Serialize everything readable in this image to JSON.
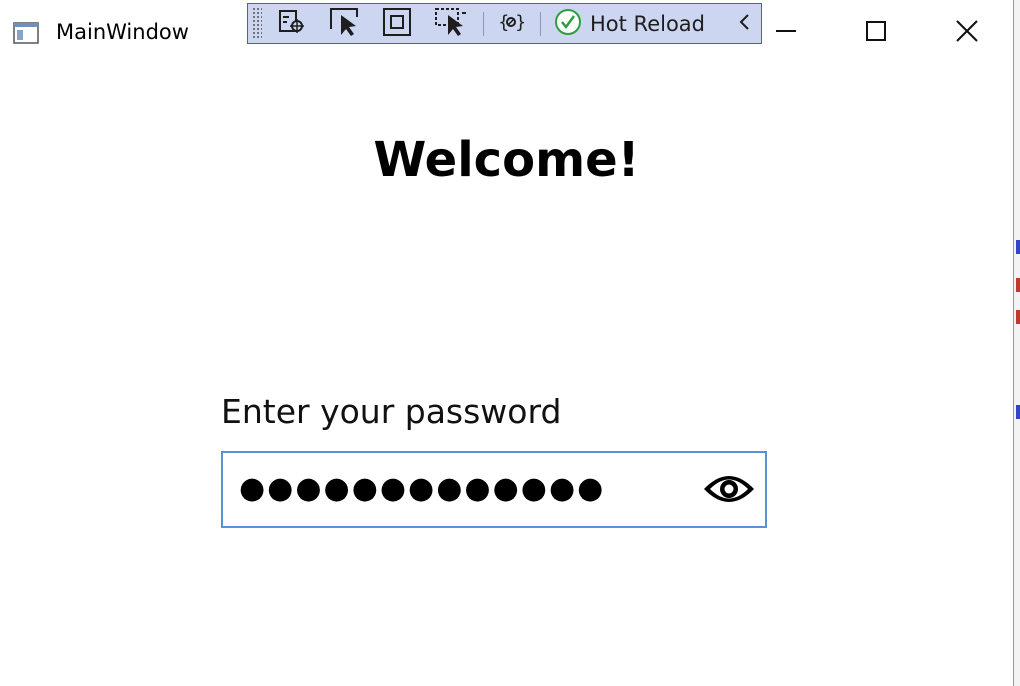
{
  "window": {
    "title": "MainWindow",
    "icons": [
      "app-icon",
      "minimize-icon",
      "maximize-icon",
      "close-icon"
    ]
  },
  "devbar": {
    "tools": [
      "visual-tree-icon",
      "select-element-icon",
      "display-adorners-icon",
      "track-focus-icon",
      "binding-failures-icon",
      "hot-reload-icon",
      "collapse-chevron-icon"
    ],
    "hot_reload_label": "Hot Reload",
    "status_color": "#2e9e3e"
  },
  "main": {
    "heading": "Welcome!",
    "password_label": "Enter your password",
    "password_mask": "●●●●●●●●●●●●●",
    "reveal_icon": "eye-icon"
  },
  "colors": {
    "devbar_bg": "#cdd6f1",
    "devbar_border": "#4a5fbd",
    "input_border": "#5b8fd6"
  }
}
